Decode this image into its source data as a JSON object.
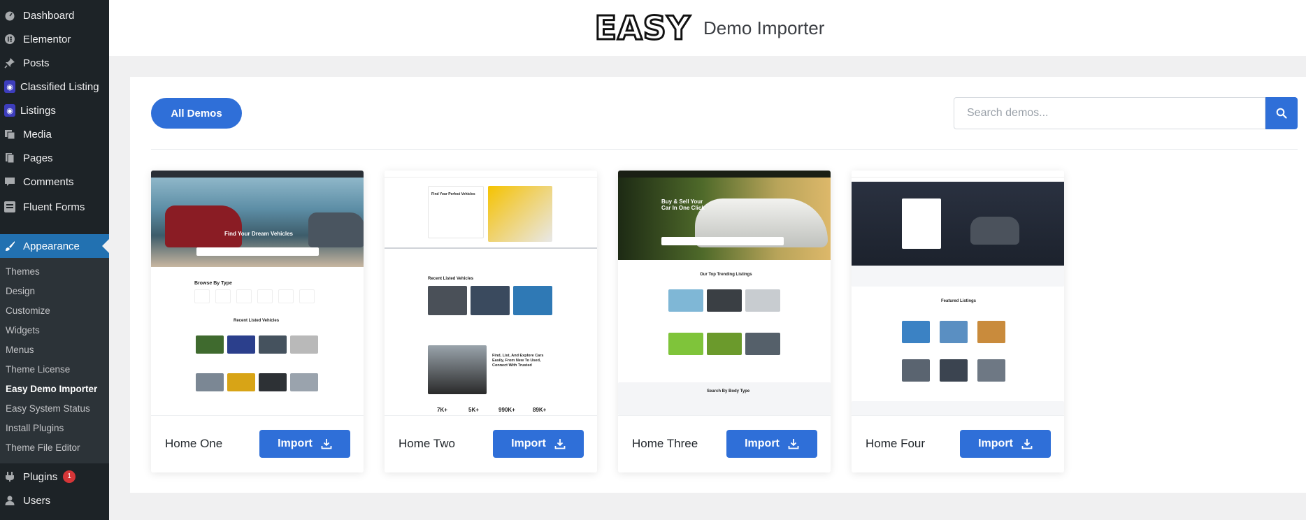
{
  "sidebar": {
    "items": [
      {
        "label": "Dashboard",
        "icon": "dashboard-icon"
      },
      {
        "label": "Elementor",
        "icon": "elementor-icon"
      },
      {
        "label": "Posts",
        "icon": "pin-icon"
      },
      {
        "label": "Classified Listing",
        "icon": "location-pin-icon"
      },
      {
        "label": "Listings",
        "icon": "location-pin-icon"
      },
      {
        "label": "Media",
        "icon": "media-icon"
      },
      {
        "label": "Pages",
        "icon": "pages-icon"
      },
      {
        "label": "Comments",
        "icon": "comment-icon"
      },
      {
        "label": "Fluent Forms",
        "icon": "forms-icon"
      },
      {
        "label": "Appearance",
        "icon": "brush-icon"
      }
    ],
    "submenu": [
      "Themes",
      "Design",
      "Customize",
      "Widgets",
      "Menus",
      "Theme License",
      "Easy Demo Importer",
      "Easy System Status",
      "Install Plugins",
      "Theme File Editor"
    ],
    "plugins": {
      "label": "Plugins",
      "badge": "1"
    },
    "users": {
      "label": "Users"
    }
  },
  "header": {
    "logo_text": "EASY",
    "title": "Demo Importer"
  },
  "toolbar": {
    "all_demos_label": "All Demos",
    "search_placeholder": "Search demos..."
  },
  "demos": [
    {
      "name": "Home One",
      "import_label": "Import",
      "hero_title": "Find Your Dream Vehicles",
      "section_a": "Browse By Type",
      "section_b": "Recent Listed Vehicles"
    },
    {
      "name": "Home Two",
      "import_label": "Import",
      "hero_title": "Find Your Perfect Vehicles",
      "section_a": "Recent Listed Vehicles",
      "section_b": "Find, List, And Explore Cars Easily, From New To Used, Connect With Trusted",
      "stats": [
        "7K+",
        "5K+",
        "990K+",
        "89K+"
      ]
    },
    {
      "name": "Home Three",
      "import_label": "Import",
      "hero_title": "Buy & Sell Your Car In One Click",
      "section_a": "Our Top Trending Listings",
      "section_b": "Search By Body Type"
    },
    {
      "name": "Home Four",
      "import_label": "Import",
      "hero_title": "",
      "section_a": "Featured Listings",
      "section_b": ""
    }
  ],
  "colors": {
    "sidebar_bg": "#1d2327",
    "active_menu": "#2271b1",
    "accent_blue": "#2f6fd8",
    "thumb_red": "#e02424"
  }
}
